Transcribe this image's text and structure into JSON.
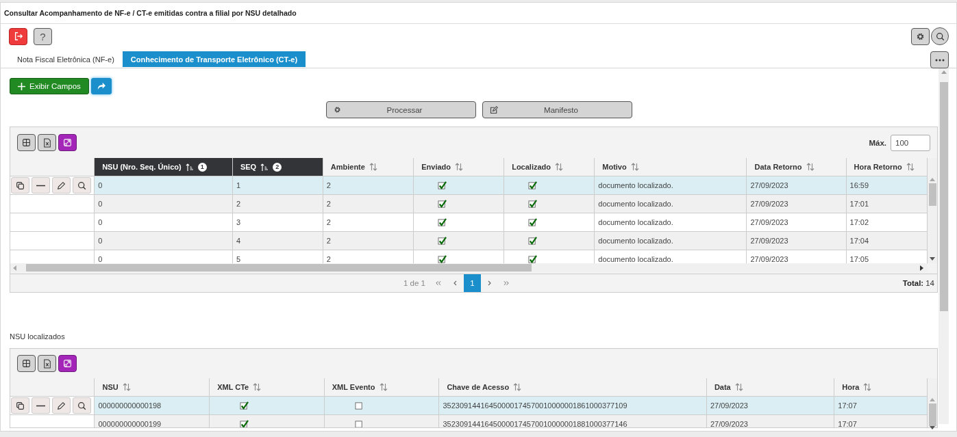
{
  "page_title": "Consultar Acompanhamento de NF-e / CT-e emitidas contra a filial por NSU detalhado",
  "toolbar": {
    "help_label": "?"
  },
  "tabs": [
    {
      "label": "Nota Fiscal Eletrônica (NF-e)",
      "selected": false
    },
    {
      "label": "Conhecimento de Transporte Eletrônico (CT-e)",
      "selected": true
    }
  ],
  "show_fields_button": "Exibir Campos",
  "process_buttons": [
    {
      "label": "Processar",
      "kind": "gear"
    },
    {
      "label": "Manifesto",
      "kind": "edit"
    }
  ],
  "grids": [
    {
      "max_label": "Máx.",
      "max_value": "100",
      "columns": [
        {
          "label": "NSU (Nro. Seq. Único)",
          "sort_rank": "1"
        },
        {
          "label": "SEQ",
          "sort_rank": "2"
        },
        {
          "label": "Ambiente"
        },
        {
          "label": "Enviado"
        },
        {
          "label": "Localizado"
        },
        {
          "label": "Motivo"
        },
        {
          "label": "Data Retorno"
        },
        {
          "label": "Hora Retorno"
        }
      ],
      "rows": [
        {
          "selected": true,
          "cells": [
            "0",
            "1",
            "2",
            {
              "checked": true
            },
            {
              "checked": true
            },
            "documento localizado.",
            "27/09/2023",
            "16:59"
          ]
        },
        {
          "selected": false,
          "cells": [
            "0",
            "2",
            "2",
            {
              "checked": true
            },
            {
              "checked": true
            },
            "documento localizado.",
            "27/09/2023",
            "17:01"
          ]
        },
        {
          "selected": false,
          "cells": [
            "0",
            "3",
            "2",
            {
              "checked": true
            },
            {
              "checked": true
            },
            "documento localizado.",
            "27/09/2023",
            "17:02"
          ]
        },
        {
          "selected": false,
          "cells": [
            "0",
            "4",
            "2",
            {
              "checked": true
            },
            {
              "checked": true
            },
            "documento localizado.",
            "27/09/2023",
            "17:04"
          ]
        },
        {
          "selected": false,
          "cells": [
            "0",
            "5",
            "2",
            {
              "checked": true
            },
            {
              "checked": true
            },
            "documento localizado.",
            "27/09/2023",
            "17:05"
          ]
        }
      ],
      "pager": {
        "summary": "1 de 1",
        "pages": [
          {
            "label": "1",
            "selected": true
          }
        ],
        "total_label": "Total:",
        "total_value": "14"
      }
    },
    {
      "title": "NSU localizados",
      "columns": [
        {
          "label": "NSU"
        },
        {
          "label": "XML CTe"
        },
        {
          "label": "XML Evento"
        },
        {
          "label": "Chave de Acesso"
        },
        {
          "label": "Data"
        },
        {
          "label": "Hora"
        }
      ],
      "rows": [
        {
          "selected": true,
          "cells": [
            "000000000000198",
            {
              "checked": true
            },
            {
              "checked": false
            },
            "35230914416450000174570010000001861000377109",
            "27/09/2023",
            "17:07"
          ]
        },
        {
          "selected": false,
          "cells": [
            "000000000000199",
            {
              "checked": true
            },
            {
              "checked": false
            },
            "35230914416450000174570010000001881000377146",
            "27/09/2023",
            "17:07"
          ]
        }
      ]
    }
  ]
}
